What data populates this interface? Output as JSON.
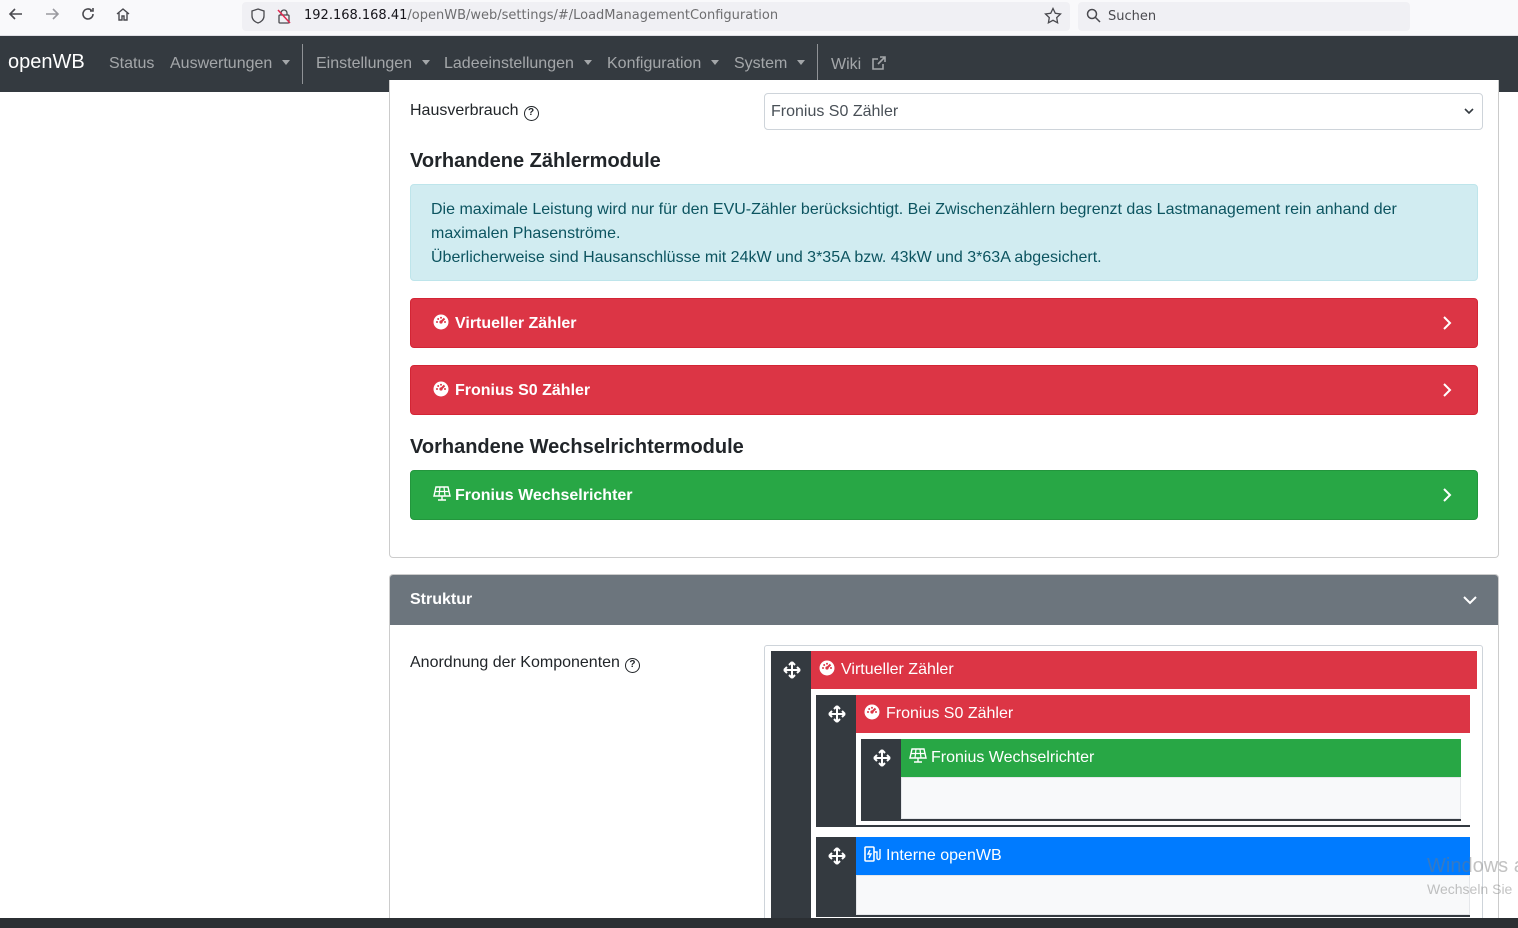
{
  "browser": {
    "url_host": "192.168.168.41",
    "url_path": "/openWB/web/settings/#/LoadManagementConfiguration",
    "search_placeholder": "Suchen"
  },
  "navbar": {
    "brand": "openWB",
    "items": [
      {
        "label": "Status"
      },
      {
        "label": "Auswertungen"
      },
      {
        "label": "Einstellungen"
      },
      {
        "label": "Ladeeinstellungen"
      },
      {
        "label": "Konfiguration"
      },
      {
        "label": "System"
      },
      {
        "label": "Wiki"
      }
    ]
  },
  "config": {
    "house_consumption_label": "Hausverbrauch",
    "house_consumption_value": "Fronius S0 Zähler",
    "meter_modules_heading": "Vorhandene Zählermodule",
    "alert_line1": "Die maximale Leistung wird nur für den EVU-Zähler berücksichtigt. Bei Zwischenzählern begrenzt das Lastmanagement rein anhand der maximalen Phasenströme.",
    "alert_line2": "Überlicherweise sind Hausanschlüsse mit 24kW und 3*35A bzw. 43kW und 3*63A abgesichert.",
    "meters": [
      {
        "label": "Virtueller Zähler",
        "icon": "gauge-icon",
        "color": "#dc3545"
      },
      {
        "label": "Fronius S0 Zähler",
        "icon": "gauge-icon",
        "color": "#dc3545"
      }
    ],
    "inverter_modules_heading": "Vorhandene Wechselrichtermodule",
    "inverters": [
      {
        "label": "Fronius Wechselrichter",
        "icon": "solar-panel-icon",
        "color": "#28a745"
      }
    ]
  },
  "structure": {
    "title": "Struktur",
    "arrangement_label": "Anordnung der Komponenten",
    "tree": {
      "virtual_meter": "Virtueller Zähler",
      "fronius_meter": "Fronius S0 Zähler",
      "fronius_inverter": "Fronius Wechselrichter",
      "internal_openwb": "Interne openWB"
    }
  },
  "watermark": {
    "line1": "Windows a",
    "line2": "Wechseln Sie"
  }
}
